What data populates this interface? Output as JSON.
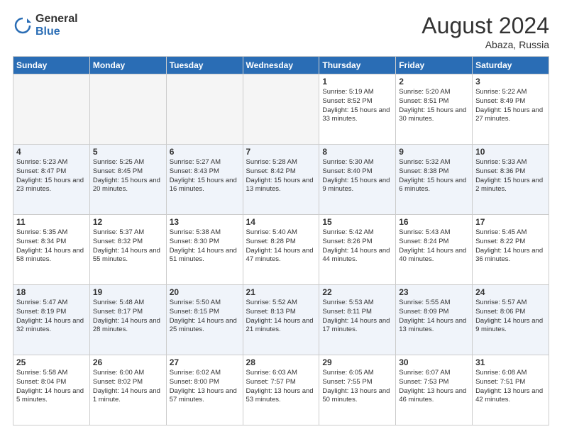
{
  "logo": {
    "general": "General",
    "blue": "Blue"
  },
  "header": {
    "month_year": "August 2024",
    "location": "Abaza, Russia"
  },
  "weekdays": [
    "Sunday",
    "Monday",
    "Tuesday",
    "Wednesday",
    "Thursday",
    "Friday",
    "Saturday"
  ],
  "weeks": [
    [
      {
        "day": "",
        "empty": true
      },
      {
        "day": "",
        "empty": true
      },
      {
        "day": "",
        "empty": true
      },
      {
        "day": "",
        "empty": true
      },
      {
        "day": "1",
        "sunrise": "5:19 AM",
        "sunset": "8:52 PM",
        "daylight": "15 hours and 33 minutes."
      },
      {
        "day": "2",
        "sunrise": "5:20 AM",
        "sunset": "8:51 PM",
        "daylight": "15 hours and 30 minutes."
      },
      {
        "day": "3",
        "sunrise": "5:22 AM",
        "sunset": "8:49 PM",
        "daylight": "15 hours and 27 minutes."
      }
    ],
    [
      {
        "day": "4",
        "sunrise": "5:23 AM",
        "sunset": "8:47 PM",
        "daylight": "15 hours and 23 minutes."
      },
      {
        "day": "5",
        "sunrise": "5:25 AM",
        "sunset": "8:45 PM",
        "daylight": "15 hours and 20 minutes."
      },
      {
        "day": "6",
        "sunrise": "5:27 AM",
        "sunset": "8:43 PM",
        "daylight": "15 hours and 16 minutes."
      },
      {
        "day": "7",
        "sunrise": "5:28 AM",
        "sunset": "8:42 PM",
        "daylight": "15 hours and 13 minutes."
      },
      {
        "day": "8",
        "sunrise": "5:30 AM",
        "sunset": "8:40 PM",
        "daylight": "15 hours and 9 minutes."
      },
      {
        "day": "9",
        "sunrise": "5:32 AM",
        "sunset": "8:38 PM",
        "daylight": "15 hours and 6 minutes."
      },
      {
        "day": "10",
        "sunrise": "5:33 AM",
        "sunset": "8:36 PM",
        "daylight": "15 hours and 2 minutes."
      }
    ],
    [
      {
        "day": "11",
        "sunrise": "5:35 AM",
        "sunset": "8:34 PM",
        "daylight": "14 hours and 58 minutes."
      },
      {
        "day": "12",
        "sunrise": "5:37 AM",
        "sunset": "8:32 PM",
        "daylight": "14 hours and 55 minutes."
      },
      {
        "day": "13",
        "sunrise": "5:38 AM",
        "sunset": "8:30 PM",
        "daylight": "14 hours and 51 minutes."
      },
      {
        "day": "14",
        "sunrise": "5:40 AM",
        "sunset": "8:28 PM",
        "daylight": "14 hours and 47 minutes."
      },
      {
        "day": "15",
        "sunrise": "5:42 AM",
        "sunset": "8:26 PM",
        "daylight": "14 hours and 44 minutes."
      },
      {
        "day": "16",
        "sunrise": "5:43 AM",
        "sunset": "8:24 PM",
        "daylight": "14 hours and 40 minutes."
      },
      {
        "day": "17",
        "sunrise": "5:45 AM",
        "sunset": "8:22 PM",
        "daylight": "14 hours and 36 minutes."
      }
    ],
    [
      {
        "day": "18",
        "sunrise": "5:47 AM",
        "sunset": "8:19 PM",
        "daylight": "14 hours and 32 minutes."
      },
      {
        "day": "19",
        "sunrise": "5:48 AM",
        "sunset": "8:17 PM",
        "daylight": "14 hours and 28 minutes."
      },
      {
        "day": "20",
        "sunrise": "5:50 AM",
        "sunset": "8:15 PM",
        "daylight": "14 hours and 25 minutes."
      },
      {
        "day": "21",
        "sunrise": "5:52 AM",
        "sunset": "8:13 PM",
        "daylight": "14 hours and 21 minutes."
      },
      {
        "day": "22",
        "sunrise": "5:53 AM",
        "sunset": "8:11 PM",
        "daylight": "14 hours and 17 minutes."
      },
      {
        "day": "23",
        "sunrise": "5:55 AM",
        "sunset": "8:09 PM",
        "daylight": "14 hours and 13 minutes."
      },
      {
        "day": "24",
        "sunrise": "5:57 AM",
        "sunset": "8:06 PM",
        "daylight": "14 hours and 9 minutes."
      }
    ],
    [
      {
        "day": "25",
        "sunrise": "5:58 AM",
        "sunset": "8:04 PM",
        "daylight": "14 hours and 5 minutes."
      },
      {
        "day": "26",
        "sunrise": "6:00 AM",
        "sunset": "8:02 PM",
        "daylight": "14 hours and 1 minute."
      },
      {
        "day": "27",
        "sunrise": "6:02 AM",
        "sunset": "8:00 PM",
        "daylight": "13 hours and 57 minutes."
      },
      {
        "day": "28",
        "sunrise": "6:03 AM",
        "sunset": "7:57 PM",
        "daylight": "13 hours and 53 minutes."
      },
      {
        "day": "29",
        "sunrise": "6:05 AM",
        "sunset": "7:55 PM",
        "daylight": "13 hours and 50 minutes."
      },
      {
        "day": "30",
        "sunrise": "6:07 AM",
        "sunset": "7:53 PM",
        "daylight": "13 hours and 46 minutes."
      },
      {
        "day": "31",
        "sunrise": "6:08 AM",
        "sunset": "7:51 PM",
        "daylight": "13 hours and 42 minutes."
      }
    ]
  ]
}
